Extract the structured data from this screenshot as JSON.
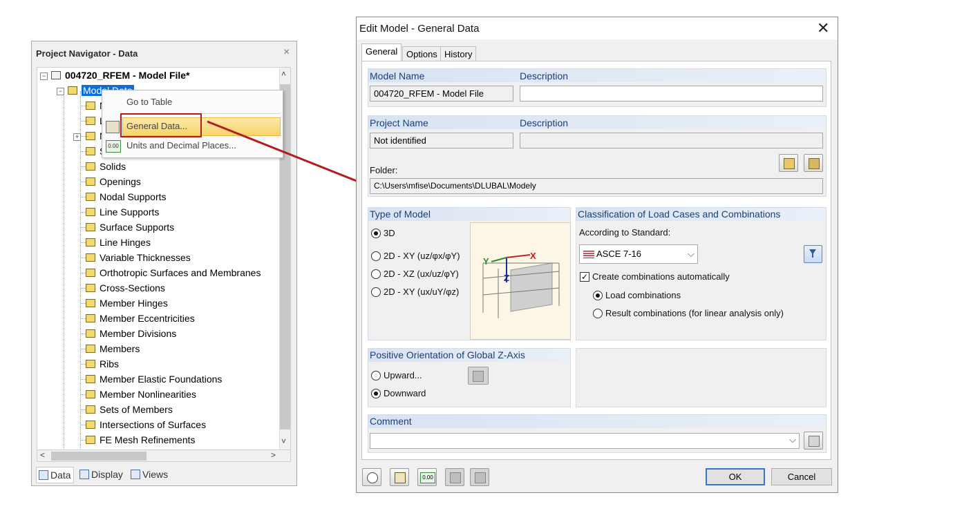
{
  "navigator": {
    "title": "Project Navigator - Data",
    "close_glyph": "×",
    "root": "004720_RFEM - Model File*",
    "model_data": "Model Data",
    "hidden_items": [
      "N",
      "L",
      "N",
      "S"
    ],
    "items": [
      "Solids",
      "Openings",
      "Nodal Supports",
      "Line Supports",
      "Surface Supports",
      "Line Hinges",
      "Variable Thicknesses",
      "Orthotropic Surfaces and Membranes",
      "Cross-Sections",
      "Member Hinges",
      "Member Eccentricities",
      "Member Divisions",
      "Members",
      "Ribs",
      "Member Elastic Foundations",
      "Member Nonlinearities",
      "Sets of Members",
      "Intersections of Surfaces",
      "FE Mesh Refinements"
    ],
    "tabs": {
      "data": "Data",
      "display": "Display",
      "views": "Views"
    },
    "scroll": {
      "up": "˄",
      "down": "˅",
      "left": "<",
      "right": ">"
    }
  },
  "context_menu": {
    "items": [
      "Go to Table",
      "General Data...",
      "Units and Decimal Places..."
    ],
    "icon_units": "0.00"
  },
  "dialog": {
    "title": "Edit Model - General Data",
    "close_glyph": "✕",
    "tabs": [
      "General",
      "Options",
      "History"
    ],
    "model": {
      "name_label": "Model Name",
      "desc_label": "Description",
      "name_value": "004720_RFEM - Model File",
      "desc_value": ""
    },
    "project": {
      "name_label": "Project Name",
      "desc_label": "Description",
      "name_value": "Not identified",
      "desc_value": "",
      "folder_label": "Folder:",
      "folder_value": "C:\\Users\\mfise\\Documents\\DLUBAL\\Modely"
    },
    "type_of_model": {
      "header": "Type of Model",
      "options": [
        "3D",
        "2D - XY (uz/φx/φY)",
        "2D - XZ (ux/uz/φY)",
        "2D - XY (ux/uY/φz)"
      ],
      "selected": 0,
      "axis_x": "X",
      "axis_y": "Y",
      "axis_z": "Z"
    },
    "classification": {
      "header": "Classification of Load Cases and Combinations",
      "standard_label": "According to Standard:",
      "standard_value": "ASCE 7-16",
      "create_label": "Create combinations automatically",
      "create_checked": true,
      "options": [
        "Load combinations",
        "Result combinations (for linear analysis only)"
      ],
      "selected": 0,
      "check_glyph": "✓",
      "dropdown_glyph": "⌵"
    },
    "orientation": {
      "header": "Positive Orientation of Global Z-Axis",
      "options": [
        "Upward...",
        "Downward"
      ],
      "selected": 1
    },
    "comment": {
      "header": "Comment",
      "value": "",
      "dropdown_glyph": "⌵"
    },
    "footer": {
      "ok": "OK",
      "cancel": "Cancel",
      "icon_units": "0.00"
    }
  },
  "colors": {
    "highlight_red": "#b11e22",
    "group_header": "#d8e3f1",
    "header_text": "#1c3f73"
  }
}
